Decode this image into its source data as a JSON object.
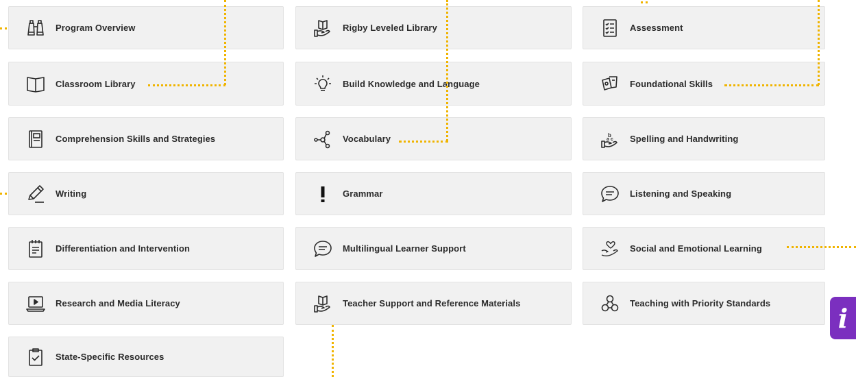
{
  "tiles": [
    {
      "name": "program-overview-tile",
      "icon": "binoculars-icon",
      "label": "Program Overview"
    },
    {
      "name": "rigby-leveled-library-tile",
      "icon": "hand-book-icon",
      "label": "Rigby Leveled Library"
    },
    {
      "name": "assessment-tile",
      "icon": "checklist-icon",
      "label": "Assessment"
    },
    {
      "name": "classroom-library-tile",
      "icon": "open-book-icon",
      "label": "Classroom Library"
    },
    {
      "name": "build-knowledge-tile",
      "icon": "lightbulb-icon",
      "label": "Build Knowledge and Language"
    },
    {
      "name": "foundational-skills-tile",
      "icon": "cards-icon",
      "label": "Foundational Skills"
    },
    {
      "name": "comprehension-tile",
      "icon": "notebook-icon",
      "label": "Comprehension Skills and Strategies"
    },
    {
      "name": "vocabulary-tile",
      "icon": "network-icon",
      "label": "Vocabulary"
    },
    {
      "name": "spelling-handwriting-tile",
      "icon": "hand-abc-icon",
      "label": "Spelling and Handwriting"
    },
    {
      "name": "writing-tile",
      "icon": "pencil-icon",
      "label": "Writing"
    },
    {
      "name": "grammar-tile",
      "icon": "exclamation-icon",
      "label": "Grammar"
    },
    {
      "name": "listening-speaking-tile",
      "icon": "speech-bubble-icon",
      "label": "Listening and Speaking"
    },
    {
      "name": "differentiation-tile",
      "icon": "calendar-note-icon",
      "label": "Differentiation and Intervention"
    },
    {
      "name": "multilingual-tile",
      "icon": "speech-bubble-icon",
      "label": "Multilingual Learner Support"
    },
    {
      "name": "social-emotional-tile",
      "icon": "hand-heart-icon",
      "label": "Social and Emotional Learning"
    },
    {
      "name": "research-media-tile",
      "icon": "laptop-play-icon",
      "label": "Research and Media Literacy"
    },
    {
      "name": "teacher-support-tile",
      "icon": "hand-book-icon",
      "label": "Teacher Support and Reference Materials"
    },
    {
      "name": "priority-standards-tile",
      "icon": "three-circles-icon",
      "label": "Teaching with Priority Standards"
    },
    {
      "name": "state-specific-tile",
      "icon": "clipboard-check-icon",
      "label": "State-Specific Resources"
    }
  ],
  "info_button": {
    "label": "i",
    "icon": "info-icon"
  },
  "colors": {
    "tile_bg": "#f1f1f1",
    "dots": "#f0b400",
    "info_bg": "#7b2fbf",
    "text": "#2b2b2b"
  }
}
